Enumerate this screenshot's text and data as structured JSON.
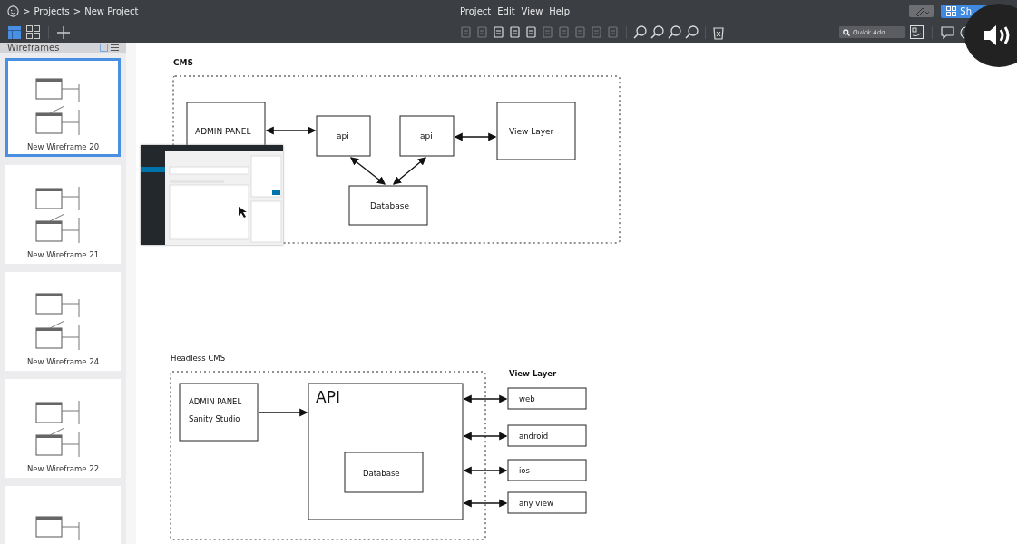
{
  "breadcrumb": [
    ">",
    "Projects",
    ">",
    "New Project"
  ],
  "menu": [
    "Project",
    "Edit",
    "View",
    "Help"
  ],
  "share_button": {
    "label": "Sh"
  },
  "quick_add": {
    "placeholder": "Quick Add"
  },
  "sidebar": {
    "title": "Wireframes",
    "items": [
      {
        "label": "New Wireframe 20",
        "selected": true
      },
      {
        "label": "New Wireframe 21",
        "selected": false
      },
      {
        "label": "New Wireframe 24",
        "selected": false
      },
      {
        "label": "New Wireframe 22",
        "selected": false
      },
      {
        "selected": false
      }
    ]
  },
  "cms": {
    "title": "CMS",
    "admin_panel": "ADMIN PANEL",
    "api_left": "api",
    "api_right": "api",
    "view_layer": "View Layer",
    "database": "Database"
  },
  "headless_cms": {
    "title": "Headless CMS",
    "admin_panel": "ADMIN PANEL",
    "admin_subtitle": "Sanity Studio",
    "api": "API",
    "database": "Database",
    "view_layer_title": "View Layer",
    "views": [
      "web",
      "android",
      "ios",
      "any view"
    ]
  }
}
